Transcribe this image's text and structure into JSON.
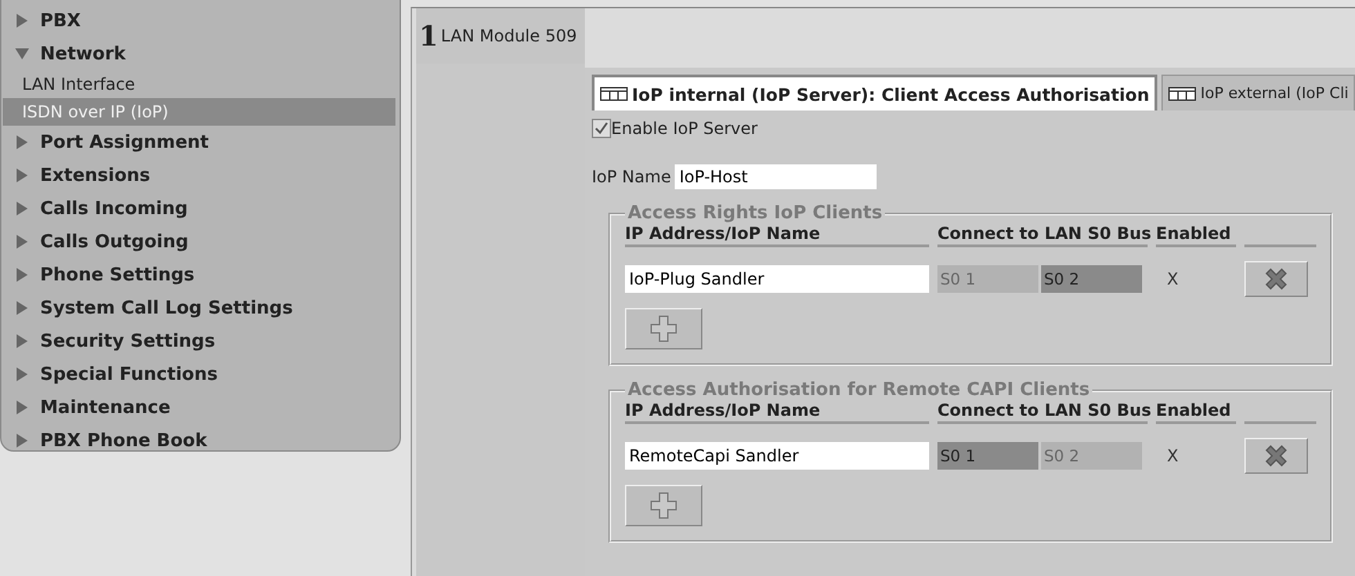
{
  "sidebar": {
    "items": [
      {
        "label": "PBX",
        "expanded": false,
        "selected": false
      },
      {
        "label": "Network",
        "expanded": true,
        "selected": false,
        "children": [
          {
            "label": "LAN Interface",
            "selected": false
          },
          {
            "label": "ISDN over IP (IoP)",
            "selected": true
          }
        ]
      },
      {
        "label": "Port Assignment",
        "expanded": false,
        "selected": false
      },
      {
        "label": "Extensions",
        "expanded": false,
        "selected": false
      },
      {
        "label": "Calls Incoming",
        "expanded": false,
        "selected": false
      },
      {
        "label": "Calls Outgoing",
        "expanded": false,
        "selected": false
      },
      {
        "label": "Phone Settings",
        "expanded": false,
        "selected": false
      },
      {
        "label": "System Call Log Settings",
        "expanded": false,
        "selected": false
      },
      {
        "label": "Security Settings",
        "expanded": false,
        "selected": false
      },
      {
        "label": "Special Functions",
        "expanded": false,
        "selected": false
      },
      {
        "label": "Maintenance",
        "expanded": false,
        "selected": false
      },
      {
        "label": "PBX Phone Book",
        "expanded": false,
        "selected": false
      }
    ]
  },
  "module": {
    "number": "1",
    "label": "LAN Module 509"
  },
  "tabs": [
    {
      "label": "IoP internal (IoP Server): Client Access Authorisation",
      "selected": true
    },
    {
      "label": "IoP external (IoP Cli",
      "selected": false
    }
  ],
  "enable_server": {
    "label": "Enable IoP Server",
    "checked": true
  },
  "iop_name": {
    "label": "IoP Name",
    "value": "IoP-Host"
  },
  "groups": [
    {
      "title": "Access Rights IoP Clients",
      "columns": [
        "IP Address/IoP Name",
        "Connect to LAN S0 Bus",
        "Enabled"
      ],
      "rows": [
        {
          "name": "IoP-Plug Sandler",
          "buses": [
            {
              "label": "S0 1",
              "selected": false
            },
            {
              "label": "S0 2",
              "selected": true
            }
          ],
          "enabled": "X"
        }
      ]
    },
    {
      "title": "Access Authorisation for Remote CAPI Clients",
      "columns": [
        "IP Address/IoP Name",
        "Connect to LAN S0 Bus",
        "Enabled"
      ],
      "rows": [
        {
          "name": "RemoteCapi Sandler",
          "buses": [
            {
              "label": "S0 1",
              "selected": true
            },
            {
              "label": "S0 2",
              "selected": false
            }
          ],
          "enabled": "X"
        }
      ]
    }
  ]
}
